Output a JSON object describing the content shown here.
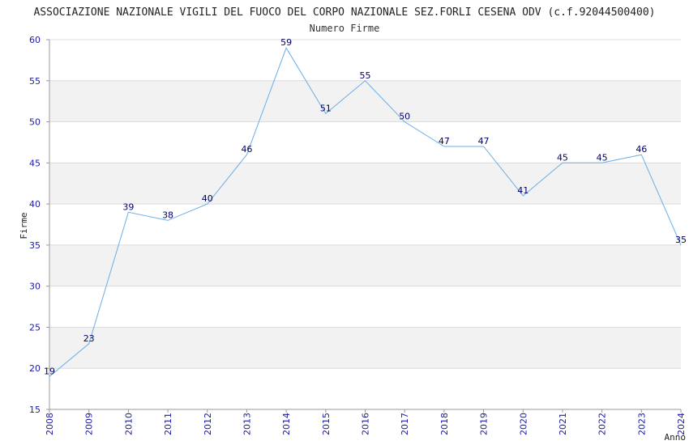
{
  "chart_data": {
    "type": "line",
    "title": "ASSOCIAZIONE NAZIONALE VIGILI DEL FUOCO DEL CORPO NAZIONALE SEZ.FORLI CESENA ODV (c.f.92044500400)",
    "subtitle": "Numero Firme",
    "xlabel": "Anno",
    "ylabel": "Firme",
    "ylim": [
      15,
      60
    ],
    "yticks": [
      15,
      20,
      25,
      30,
      35,
      40,
      45,
      50,
      55,
      60
    ],
    "x": [
      "2008",
      "2009",
      "2010",
      "2011",
      "2012",
      "2013",
      "2014",
      "2015",
      "2016",
      "2017",
      "2018",
      "2019",
      "2020",
      "2021",
      "2022",
      "2023",
      "2024"
    ],
    "series": [
      {
        "values": [
          19,
          23,
          39,
          38,
          40,
          46,
          59,
          51,
          55,
          50,
          47,
          47,
          41,
          45,
          45,
          46,
          35
        ]
      }
    ],
    "grid": true,
    "colors": {
      "line": "#6aaee8",
      "band": "#f2f2f2",
      "grid": "#dcdcdc",
      "tick_text": "#1a1aa6",
      "data_label": "#000066"
    }
  }
}
